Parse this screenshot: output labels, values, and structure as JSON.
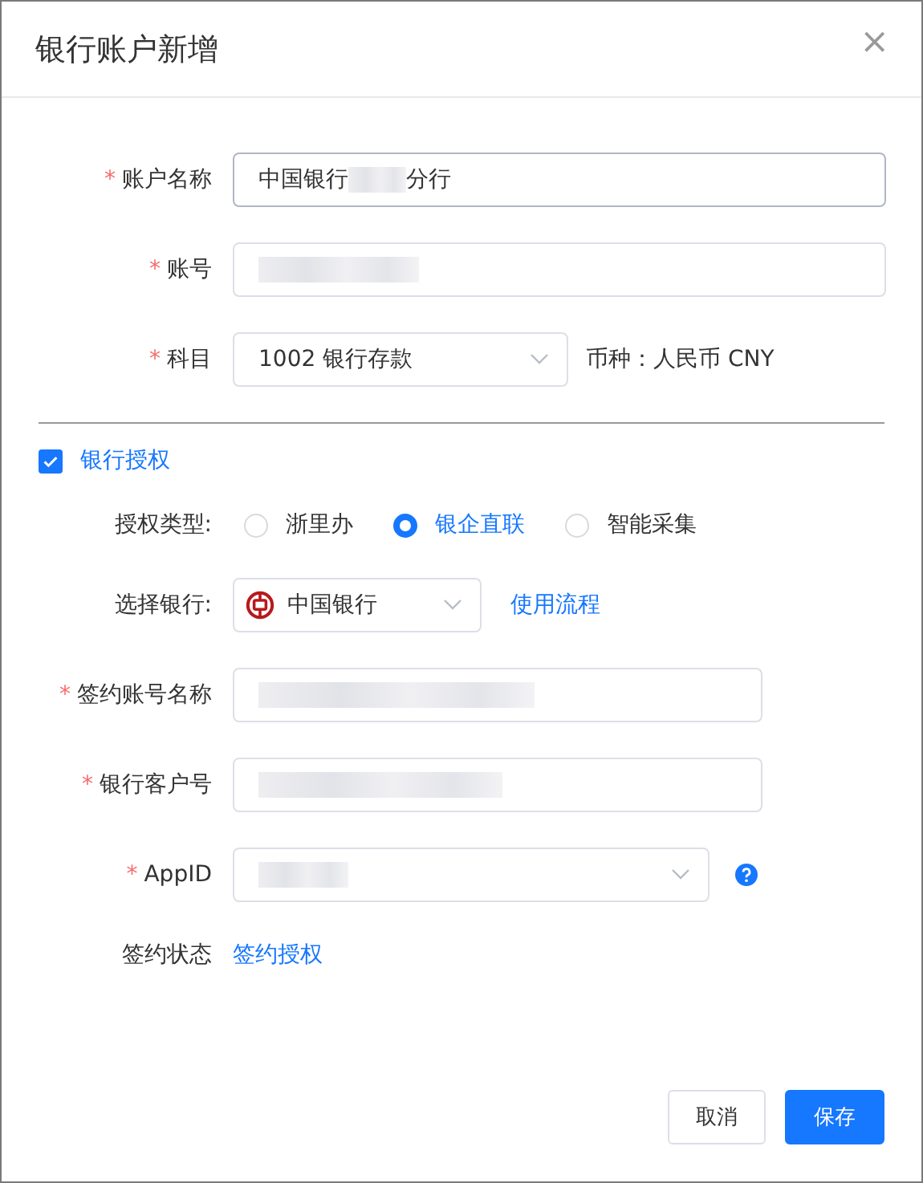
{
  "dialog": {
    "title": "银行账户新增",
    "close": "×"
  },
  "fields": [
    {
      "kind": "text",
      "label": "账户名称",
      "required_mark": "*",
      "value": "中国银行",
      "value_tail": "分行",
      "redacted": true,
      "focused": true
    },
    {
      "kind": "text",
      "label": "账号",
      "required_mark": "*",
      "redacted": true,
      "focused": false
    },
    {
      "kind": "select",
      "label": "科目",
      "required_mark": "*",
      "value": "1002 银行存款",
      "note": "币种：人民币 CNY"
    }
  ],
  "bank_auth": {
    "label": "银行授权",
    "checked": true,
    "auth_type": {
      "label": "授权类型:",
      "options": [
        {
          "label": "浙里办",
          "selected": false
        },
        {
          "label": "银企直联",
          "selected": true
        },
        {
          "label": "智能采集",
          "selected": false
        }
      ]
    },
    "bank": {
      "label": "选择银行:",
      "value": "中国银行",
      "link": "使用流程"
    },
    "fields": [
      {
        "kind": "text",
        "label": "签约账号名称",
        "required_mark": "*",
        "redacted": true
      },
      {
        "kind": "text",
        "label": "银行客户号",
        "required_mark": "*",
        "redacted": true
      },
      {
        "kind": "select",
        "label": "AppID",
        "required_mark": "*",
        "redacted": true,
        "help": true
      }
    ],
    "status": {
      "label": "签约状态",
      "link": "签约授权"
    }
  },
  "buttons": [
    {
      "label": "取消",
      "kind": "secondary"
    },
    {
      "label": "保存",
      "kind": "primary"
    }
  ]
}
